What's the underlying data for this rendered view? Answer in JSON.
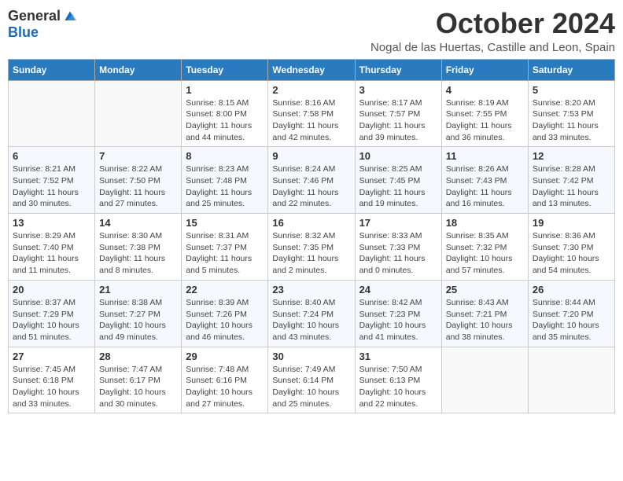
{
  "header": {
    "logo_general": "General",
    "logo_blue": "Blue",
    "month_title": "October 2024",
    "location": "Nogal de las Huertas, Castille and Leon, Spain"
  },
  "days_of_week": [
    "Sunday",
    "Monday",
    "Tuesday",
    "Wednesday",
    "Thursday",
    "Friday",
    "Saturday"
  ],
  "weeks": [
    [
      {
        "day": "",
        "info": ""
      },
      {
        "day": "",
        "info": ""
      },
      {
        "day": "1",
        "info": "Sunrise: 8:15 AM\nSunset: 8:00 PM\nDaylight: 11 hours and 44 minutes."
      },
      {
        "day": "2",
        "info": "Sunrise: 8:16 AM\nSunset: 7:58 PM\nDaylight: 11 hours and 42 minutes."
      },
      {
        "day": "3",
        "info": "Sunrise: 8:17 AM\nSunset: 7:57 PM\nDaylight: 11 hours and 39 minutes."
      },
      {
        "day": "4",
        "info": "Sunrise: 8:19 AM\nSunset: 7:55 PM\nDaylight: 11 hours and 36 minutes."
      },
      {
        "day": "5",
        "info": "Sunrise: 8:20 AM\nSunset: 7:53 PM\nDaylight: 11 hours and 33 minutes."
      }
    ],
    [
      {
        "day": "6",
        "info": "Sunrise: 8:21 AM\nSunset: 7:52 PM\nDaylight: 11 hours and 30 minutes."
      },
      {
        "day": "7",
        "info": "Sunrise: 8:22 AM\nSunset: 7:50 PM\nDaylight: 11 hours and 27 minutes."
      },
      {
        "day": "8",
        "info": "Sunrise: 8:23 AM\nSunset: 7:48 PM\nDaylight: 11 hours and 25 minutes."
      },
      {
        "day": "9",
        "info": "Sunrise: 8:24 AM\nSunset: 7:46 PM\nDaylight: 11 hours and 22 minutes."
      },
      {
        "day": "10",
        "info": "Sunrise: 8:25 AM\nSunset: 7:45 PM\nDaylight: 11 hours and 19 minutes."
      },
      {
        "day": "11",
        "info": "Sunrise: 8:26 AM\nSunset: 7:43 PM\nDaylight: 11 hours and 16 minutes."
      },
      {
        "day": "12",
        "info": "Sunrise: 8:28 AM\nSunset: 7:42 PM\nDaylight: 11 hours and 13 minutes."
      }
    ],
    [
      {
        "day": "13",
        "info": "Sunrise: 8:29 AM\nSunset: 7:40 PM\nDaylight: 11 hours and 11 minutes."
      },
      {
        "day": "14",
        "info": "Sunrise: 8:30 AM\nSunset: 7:38 PM\nDaylight: 11 hours and 8 minutes."
      },
      {
        "day": "15",
        "info": "Sunrise: 8:31 AM\nSunset: 7:37 PM\nDaylight: 11 hours and 5 minutes."
      },
      {
        "day": "16",
        "info": "Sunrise: 8:32 AM\nSunset: 7:35 PM\nDaylight: 11 hours and 2 minutes."
      },
      {
        "day": "17",
        "info": "Sunrise: 8:33 AM\nSunset: 7:33 PM\nDaylight: 11 hours and 0 minutes."
      },
      {
        "day": "18",
        "info": "Sunrise: 8:35 AM\nSunset: 7:32 PM\nDaylight: 10 hours and 57 minutes."
      },
      {
        "day": "19",
        "info": "Sunrise: 8:36 AM\nSunset: 7:30 PM\nDaylight: 10 hours and 54 minutes."
      }
    ],
    [
      {
        "day": "20",
        "info": "Sunrise: 8:37 AM\nSunset: 7:29 PM\nDaylight: 10 hours and 51 minutes."
      },
      {
        "day": "21",
        "info": "Sunrise: 8:38 AM\nSunset: 7:27 PM\nDaylight: 10 hours and 49 minutes."
      },
      {
        "day": "22",
        "info": "Sunrise: 8:39 AM\nSunset: 7:26 PM\nDaylight: 10 hours and 46 minutes."
      },
      {
        "day": "23",
        "info": "Sunrise: 8:40 AM\nSunset: 7:24 PM\nDaylight: 10 hours and 43 minutes."
      },
      {
        "day": "24",
        "info": "Sunrise: 8:42 AM\nSunset: 7:23 PM\nDaylight: 10 hours and 41 minutes."
      },
      {
        "day": "25",
        "info": "Sunrise: 8:43 AM\nSunset: 7:21 PM\nDaylight: 10 hours and 38 minutes."
      },
      {
        "day": "26",
        "info": "Sunrise: 8:44 AM\nSunset: 7:20 PM\nDaylight: 10 hours and 35 minutes."
      }
    ],
    [
      {
        "day": "27",
        "info": "Sunrise: 7:45 AM\nSunset: 6:18 PM\nDaylight: 10 hours and 33 minutes."
      },
      {
        "day": "28",
        "info": "Sunrise: 7:47 AM\nSunset: 6:17 PM\nDaylight: 10 hours and 30 minutes."
      },
      {
        "day": "29",
        "info": "Sunrise: 7:48 AM\nSunset: 6:16 PM\nDaylight: 10 hours and 27 minutes."
      },
      {
        "day": "30",
        "info": "Sunrise: 7:49 AM\nSunset: 6:14 PM\nDaylight: 10 hours and 25 minutes."
      },
      {
        "day": "31",
        "info": "Sunrise: 7:50 AM\nSunset: 6:13 PM\nDaylight: 10 hours and 22 minutes."
      },
      {
        "day": "",
        "info": ""
      },
      {
        "day": "",
        "info": ""
      }
    ]
  ]
}
